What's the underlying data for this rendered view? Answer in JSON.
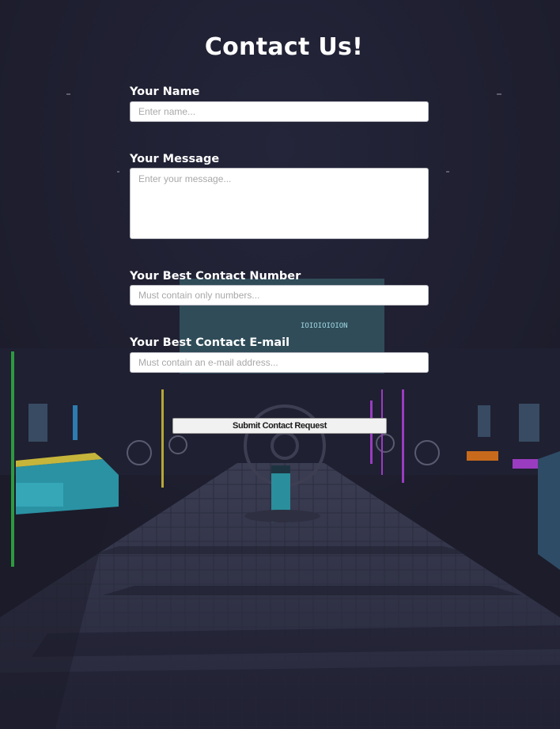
{
  "page": {
    "title": "Contact Us!"
  },
  "form": {
    "name": {
      "label": "Your Name",
      "placeholder": "Enter name..."
    },
    "message": {
      "label": "Your Message",
      "placeholder": "Enter your message..."
    },
    "number": {
      "label": "Your Best Contact Number",
      "placeholder": "Must contain only numbers..."
    },
    "email": {
      "label": "Your Best Contact E-mail",
      "placeholder": "Must contain an e-mail address..."
    },
    "submit_label": "Submit Contact Request"
  },
  "background": {
    "screen_text": "IOIOIOIOION",
    "icons": [
      "at-sign-icon"
    ]
  },
  "colors": {
    "background": "#1d1d2d",
    "floor": "#34354a",
    "accent_cyan": "#39a5b5",
    "accent_yellow": "#c6b53b",
    "accent_green": "#3da84c",
    "accent_purple": "#9a3cc0"
  }
}
